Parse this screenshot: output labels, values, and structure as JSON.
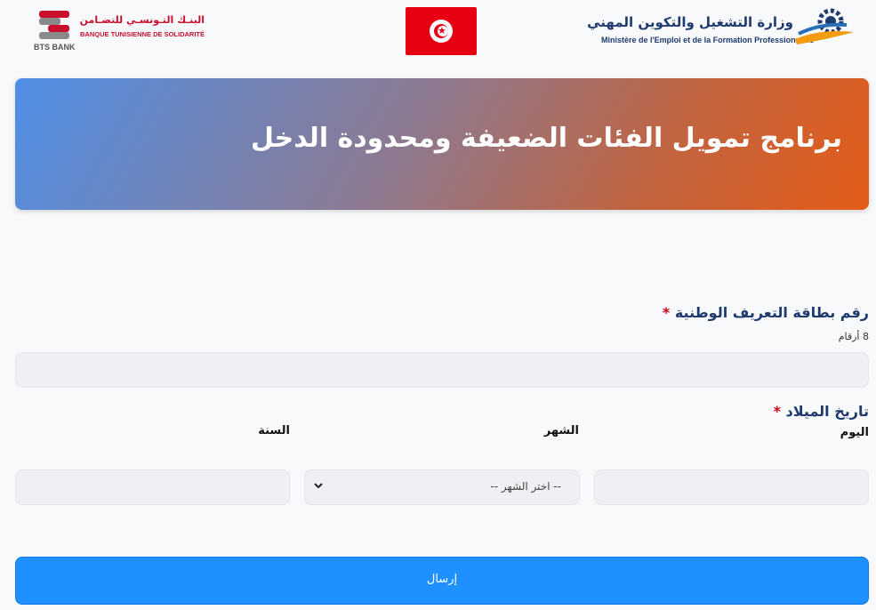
{
  "header": {
    "bts_logo": {
      "arabic": "البنـك التـونسـي للتضـامن",
      "french": "BANQUE TUNISIENNE DE SOLIDARITÉ",
      "short": "BTS BANK"
    },
    "flag_icon": "tunisia-flag",
    "ministry_logo": {
      "arabic": "وزارة التشغيل والتكوين المهني",
      "french": "Ministère de l'Emploi et de la Formation Professionnelle"
    }
  },
  "banner": {
    "title": "برنامج تمويل الفئات الضعيفة ومحدودة الدخل"
  },
  "form": {
    "cin": {
      "label": "رقم بطاقة التعريف الوطنية",
      "required_mark": "*",
      "hint": "8 أرقام",
      "value": ""
    },
    "birthdate": {
      "label": "تاريخ الميلاد",
      "required_mark": "*",
      "day_label": "اليوم",
      "month_label": "الشهر",
      "year_label": "السنة",
      "month_placeholder": "-- اختر الشهر --",
      "day_value": "",
      "year_value": ""
    },
    "submit_label": "إرسال"
  },
  "colors": {
    "banner_start": "#4f8fe6",
    "banner_end": "#e45c18",
    "label": "#1e3a6e",
    "required": "#d0021b",
    "submit": "#1e90ff"
  }
}
